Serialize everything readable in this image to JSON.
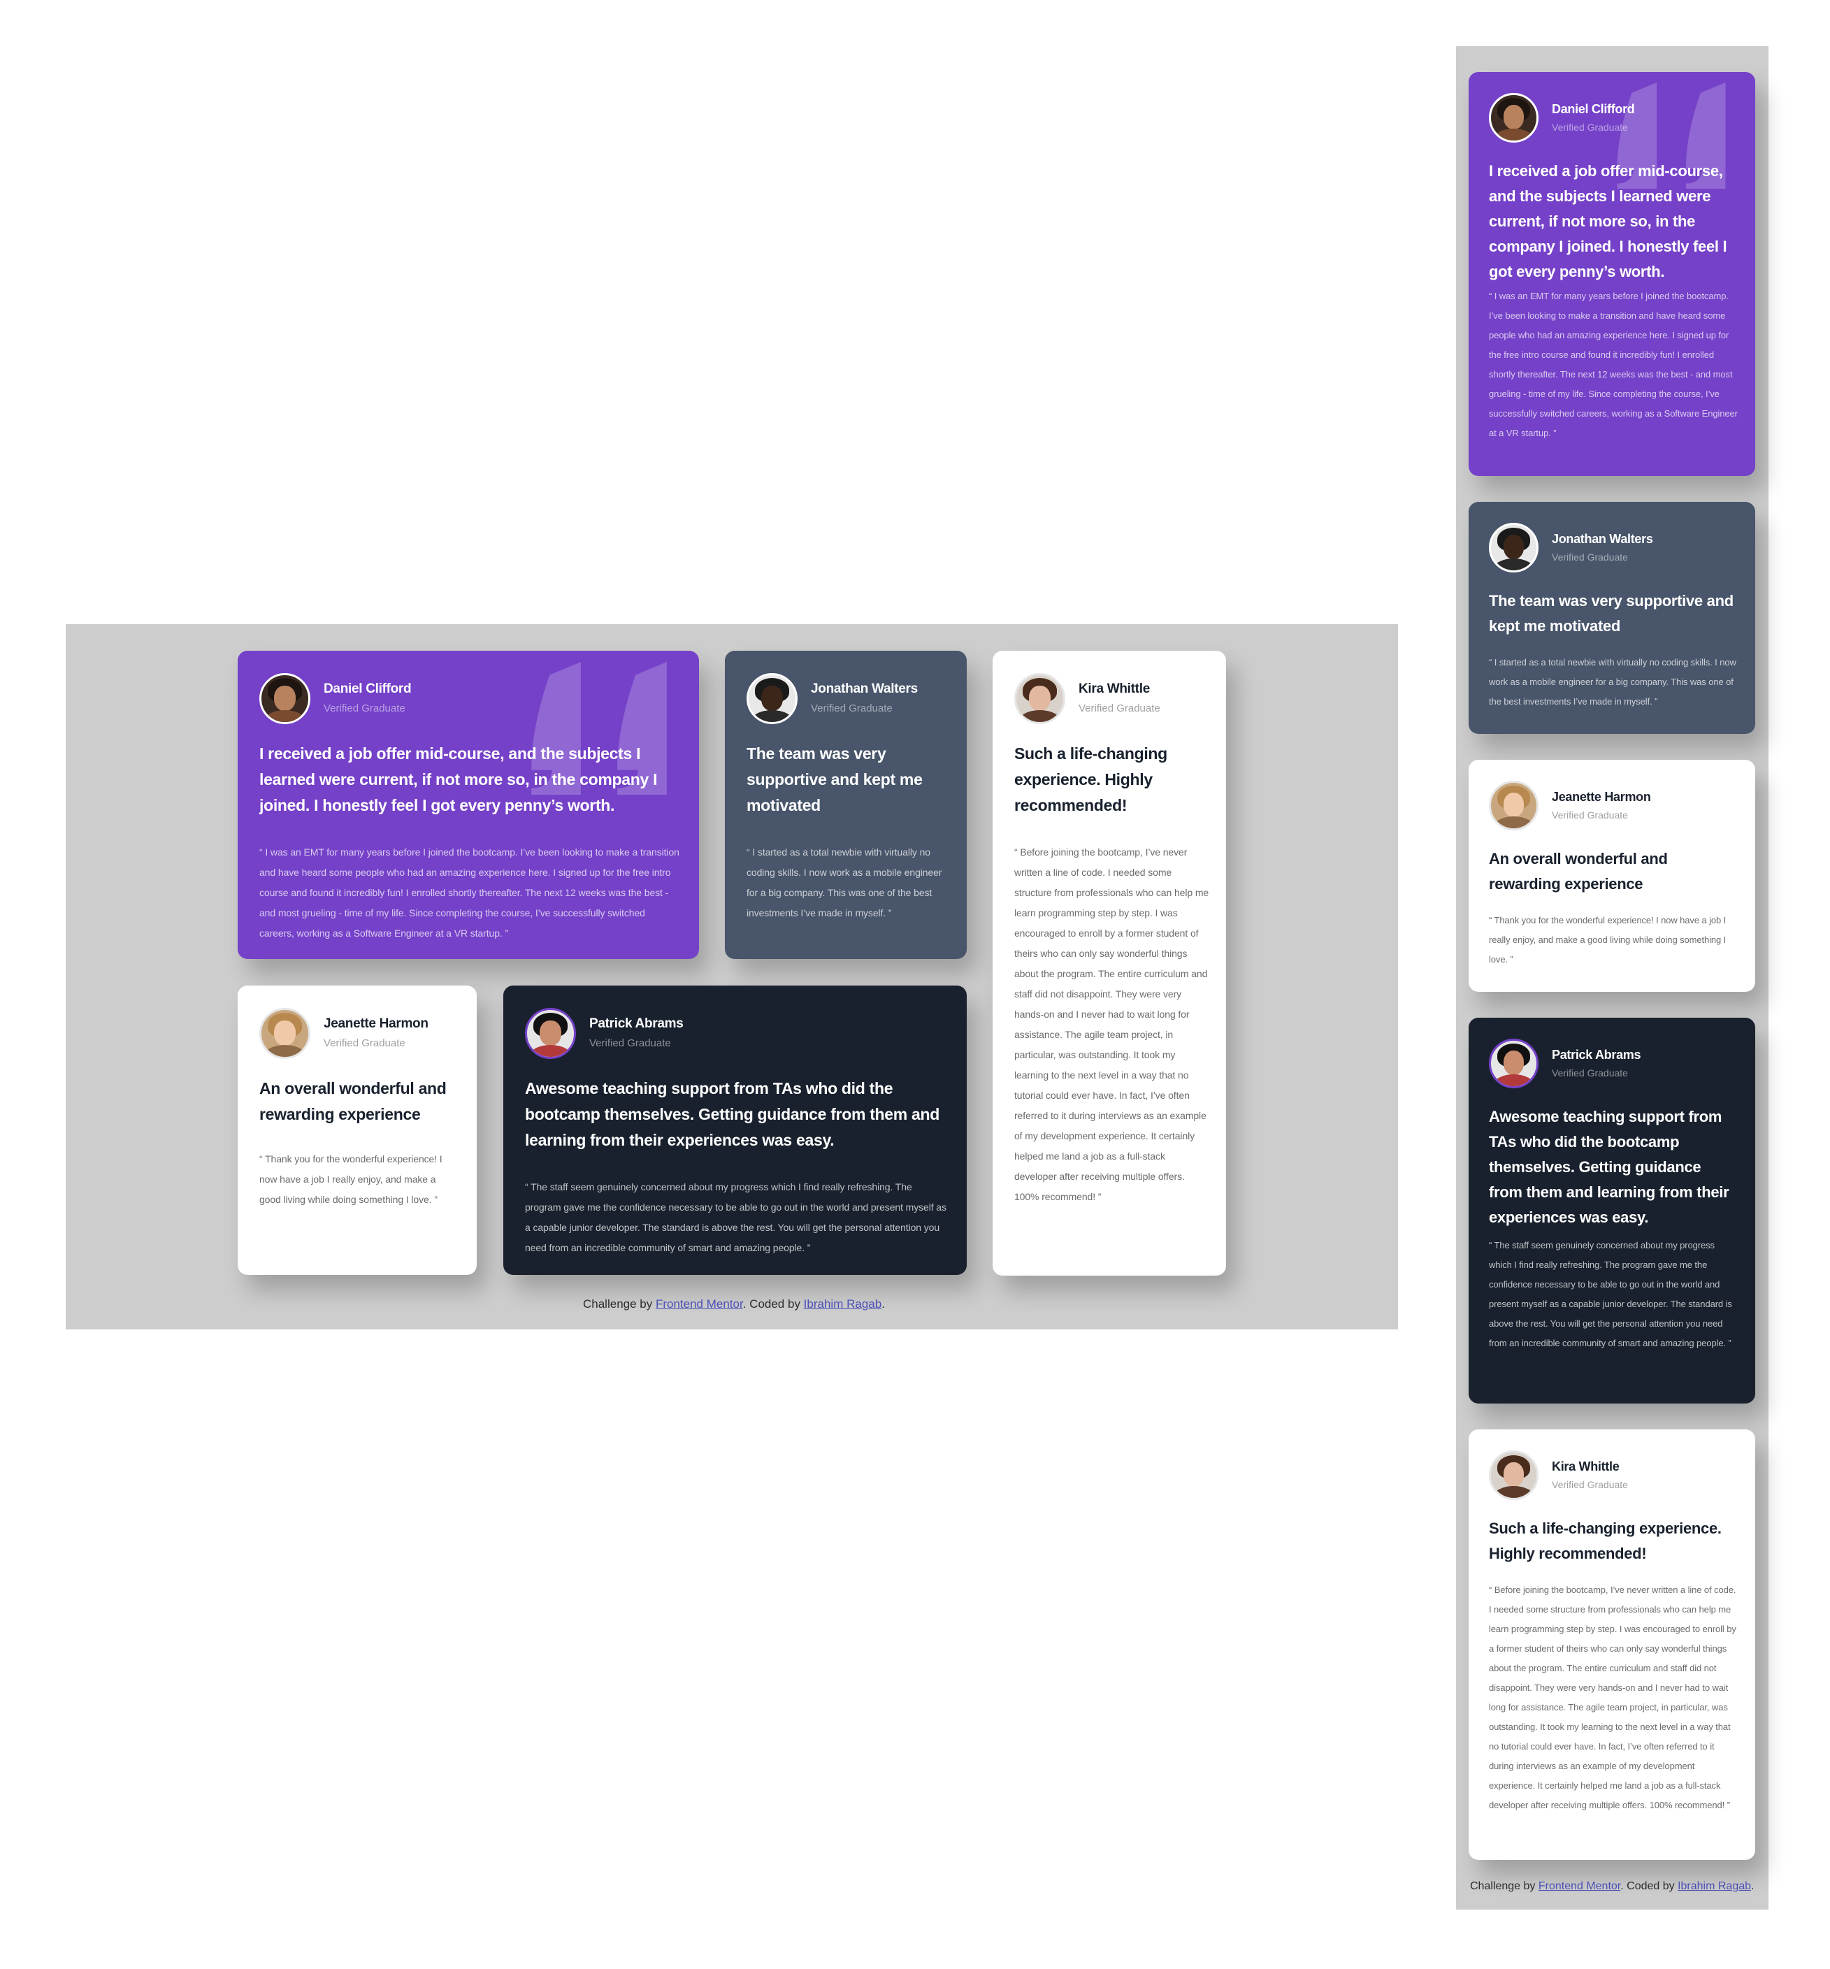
{
  "colors": {
    "purple": "#7541c8",
    "slate": "#48556a",
    "white": "#ffffff",
    "dark": "#19212e",
    "backdrop": "#cdcdcd",
    "link": "#4a4fb5"
  },
  "icons": {
    "quote": "quote-icon"
  },
  "testimonials": {
    "daniel": {
      "name": "Daniel Clifford",
      "role": "Verified Graduate",
      "headline": "I received a job offer mid-course, and the subjects I learned were current, if not more so, in the company I joined. I honestly feel I got every penny’s worth.",
      "quote": "“ I was an EMT for many years before I joined the bootcamp. I’ve been looking to make a transition and have heard some people who had an amazing experience here. I signed up for the free intro course and found it incredibly fun! I enrolled shortly thereafter. The next 12 weeks was the best - and most grueling - time of my life. Since completing the course, I’ve successfully switched careers, working as a Software Engineer at a VR startup. ”"
    },
    "jonathan": {
      "name": "Jonathan Walters",
      "role": "Verified Graduate",
      "headline": "The team was very supportive and kept me motivated",
      "quote": "“ I started as a total newbie with virtually no coding skills. I now work as a mobile engineer for a big company. This was one of the best investments I’ve made in myself. ”"
    },
    "kira": {
      "name": "Kira Whittle",
      "role": "Verified Graduate",
      "headline": "Such a life-changing experience. Highly recommended!",
      "quote": "“ Before joining the bootcamp, I’ve never written a line of code. I needed some structure from professionals who can help me learn programming step by step. I was encouraged to enroll by a former student of theirs who can only say wonderful things about the program. The entire curriculum and staff did not disappoint. They were very hands-on and I never had to wait long for assistance. The agile team project, in particular, was outstanding. It took my learning to the next level in a way that no tutorial could ever have. In fact, I’ve often referred to it during interviews as an example of my development experience. It certainly helped me land a job as a full-stack developer after receiving multiple offers. 100% recommend! ”"
    },
    "jeanette": {
      "name": "Jeanette Harmon",
      "role": "Verified Graduate",
      "headline": "An overall wonderful and rewarding experience",
      "quote": "“ Thank you for the wonderful experience! I now have a job I really enjoy, and make a good living while doing something I love. ”"
    },
    "patrick": {
      "name": "Patrick Abrams",
      "role": "Verified Graduate",
      "headline": "Awesome teaching support from TAs who did the bootcamp themselves. Getting guidance from them and learning from their experiences was easy.",
      "quote": "“ The staff seem genuinely concerned about my progress which I find really refreshing. The program gave me the confidence necessary to be able to go out in the world and present myself as a capable junior developer. The standard is above the rest. You will get the personal attention you need from an incredible community of smart and amazing people. ”"
    }
  },
  "attribution": {
    "prefix": "Challenge by ",
    "link1": "Frontend Mentor",
    "middle": ". Coded by ",
    "link2": "Ibrahim Ragab",
    "suffix": "."
  }
}
